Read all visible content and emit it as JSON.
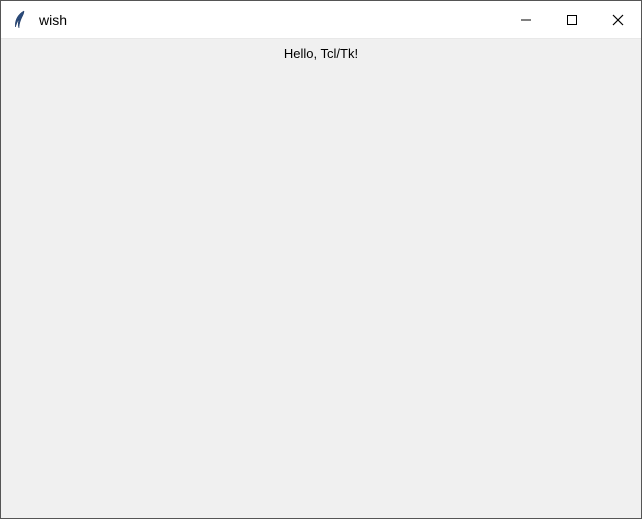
{
  "window": {
    "title": "wish"
  },
  "content": {
    "label_text": "Hello, Tcl/Tk!"
  }
}
